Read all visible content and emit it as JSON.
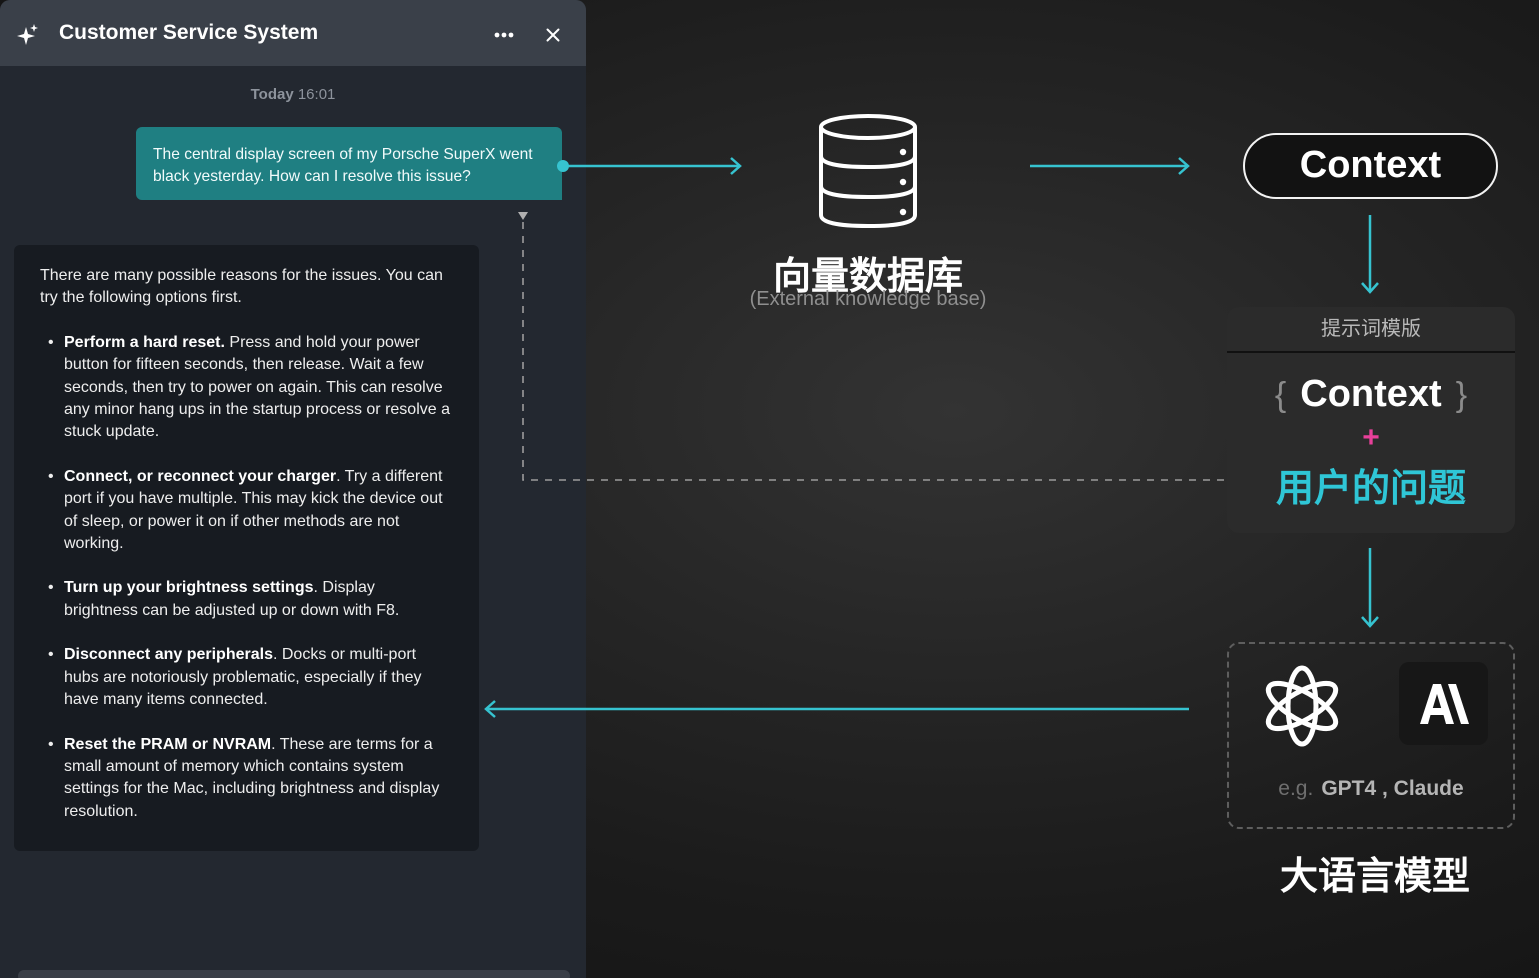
{
  "chat": {
    "title": "Customer Service System",
    "date_label": "Today",
    "time": "16:01",
    "user_message": "The central display screen of my Porsche SuperX went black yesterday. How can I resolve this issue?",
    "assistant_intro": "There are many possible reasons for the issues. You can try the following options first.",
    "tips": [
      {
        "title": "Perform a hard reset.",
        "body": " Press and hold your power button for fifteen seconds, then release. Wait a few seconds, then try to power on again. This can resolve any minor hang ups in the startup process or resolve a stuck update."
      },
      {
        "title": "Connect, or reconnect your charger",
        "body": ". Try a different port if you have multiple. This may kick the device out of sleep, or power it on if other methods are not working."
      },
      {
        "title": "Turn up your brightness settings",
        "body": ".  Display brightness can be adjusted up or down with F8."
      },
      {
        "title": "Disconnect any peripherals",
        "body": ". Docks or multi-port hubs are notoriously problematic, especially if they have many items connected."
      },
      {
        "title": "Reset the PRAM or NVRAM",
        "body": ". These are terms for a small amount of memory which contains system settings for the Mac, including brightness and display resolution."
      }
    ],
    "bullet": "•"
  },
  "diagram": {
    "database": {
      "label": "向量数据库",
      "sublabel": "(External knowledge base)"
    },
    "context_label": "Context",
    "template": {
      "title": "提示词模版",
      "brace_open": "{",
      "brace_close": "}",
      "context": "Context",
      "plus": "+",
      "question": "用户的问题"
    },
    "llm": {
      "examples_prefix": "e.g.",
      "examples": "GPT4 , Claude",
      "label": "大语言模型"
    }
  },
  "icons": {
    "header_left": "sparkle-icon",
    "header_menu": "more-icon",
    "header_close": "close-icon",
    "database": "database-icon",
    "openai": "openai-logo-icon",
    "anthropic": "anthropic-logo-icon"
  },
  "colors": {
    "arrow": "#36c3d0",
    "user_bubble": "#1f7f82",
    "question_text": "#2fc6d6",
    "plus": "#e8409a",
    "panel": "#232830",
    "header": "#3a4049"
  }
}
